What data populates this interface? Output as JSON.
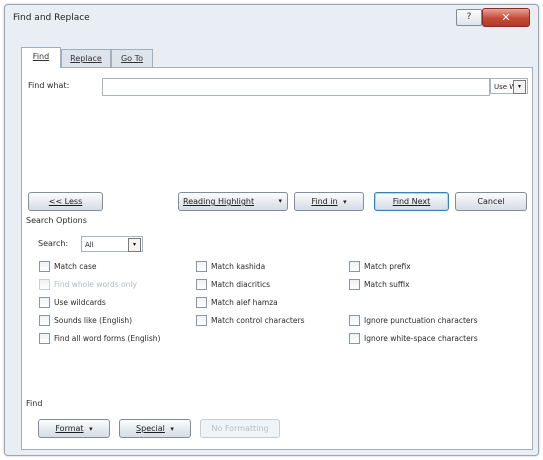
{
  "window": {
    "title": "Find and Replace",
    "help_label": "?",
    "close_label": "✕"
  },
  "tabs": [
    {
      "label": "Find"
    },
    {
      "label": "Replace"
    },
    {
      "label": "Go To"
    }
  ],
  "find": {
    "label": "Find what:",
    "value": "",
    "options_combo": "Use WB"
  },
  "buttons": {
    "less": "<< Less",
    "reading_highlight": "Reading Highlight",
    "find_in": "Find in",
    "find_next": "Find Next",
    "cancel": "Cancel",
    "format": "Format",
    "special": "Special",
    "no_formatting": "No Formatting"
  },
  "search_options": {
    "heading": "Search Options",
    "search_label": "Search:",
    "search_value": "All",
    "checkboxes_col1": [
      {
        "label": "Match case",
        "checked": false,
        "enabled": true
      },
      {
        "label": "Find whole words only",
        "checked": false,
        "enabled": false
      },
      {
        "label": "Use wildcards",
        "checked": false,
        "enabled": true
      },
      {
        "label": "Sounds like (English)",
        "checked": false,
        "enabled": true
      },
      {
        "label": "Find all word forms (English)",
        "checked": false,
        "enabled": true
      }
    ],
    "checkboxes_col2": [
      {
        "label": "Match kashida",
        "checked": false,
        "enabled": true
      },
      {
        "label": "Match diacritics",
        "checked": false,
        "enabled": true
      },
      {
        "label": "Match alef hamza",
        "checked": false,
        "enabled": true
      },
      {
        "label": "Match control characters",
        "checked": false,
        "enabled": true
      }
    ],
    "checkboxes_col3": [
      {
        "label": "Match prefix",
        "checked": false,
        "enabled": true
      },
      {
        "label": "Match suffix",
        "checked": false,
        "enabled": true
      },
      {
        "label": "Ignore punctuation characters",
        "checked": false,
        "enabled": true
      },
      {
        "label": "Ignore white-space characters",
        "checked": false,
        "enabled": true
      }
    ]
  },
  "footer": {
    "heading": "Find"
  },
  "icons": {
    "dropdown": "▾"
  }
}
